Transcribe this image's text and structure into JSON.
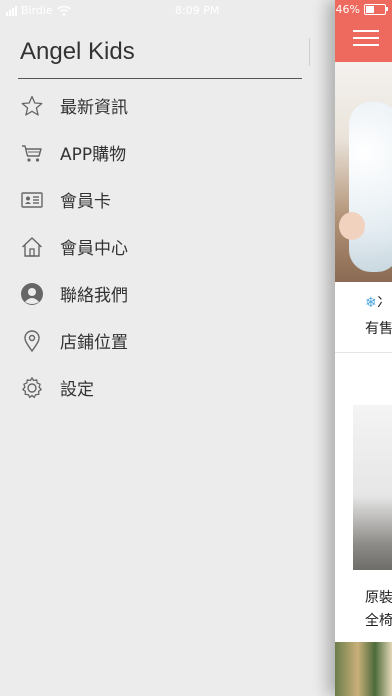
{
  "status_bar": {
    "carrier": "Birdie",
    "time": "8:09 PM",
    "battery": "46%"
  },
  "drawer": {
    "title": "Angel Kids",
    "items": [
      {
        "label": "最新資訊",
        "icon": "star-icon"
      },
      {
        "label": "APP購物",
        "icon": "cart-icon"
      },
      {
        "label": "會員卡",
        "icon": "member-card-icon"
      },
      {
        "label": "會員中心",
        "icon": "home-icon"
      },
      {
        "label": "聯絡我們",
        "icon": "contact-person-icon"
      },
      {
        "label": "店鋪位置",
        "icon": "location-pin-icon"
      },
      {
        "label": "設定",
        "icon": "gear-icon"
      }
    ]
  },
  "content": {
    "header_color": "#ee6a5f",
    "cards": [
      {
        "line1": "冫",
        "line2": "有售"
      },
      {
        "line1": "原裝",
        "line2": "全椅"
      }
    ]
  }
}
